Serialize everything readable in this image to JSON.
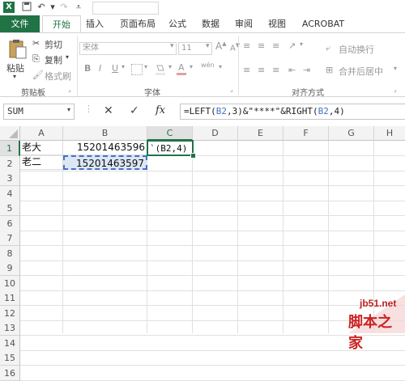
{
  "tabs": [
    "文件",
    "开始",
    "插入",
    "页面布局",
    "公式",
    "数据",
    "审阅",
    "视图",
    "ACROBAT"
  ],
  "clipboard": {
    "cut": "剪切",
    "copy": "复制",
    "format_painter": "格式刷",
    "paste": "粘贴",
    "group": "剪贴板"
  },
  "font": {
    "name": "宋体",
    "size": "11",
    "group": "字体",
    "bold": "B",
    "italic": "I",
    "underline": "U",
    "font_color": "A",
    "phonetic": "wén"
  },
  "alignment": {
    "wrap": "自动换行",
    "merge": "合并后居中",
    "group": "对齐方式"
  },
  "formula_bar": {
    "name_box": "SUM",
    "cancel": "✕",
    "confirm": "✓",
    "fx": "fx",
    "formula_parts": [
      "=LEFT(",
      "B2",
      ",3)&\"****\"&RIGHT(",
      "B2",
      ",4)"
    ]
  },
  "columns": [
    "A",
    "B",
    "C",
    "D",
    "E",
    "F",
    "G",
    "H"
  ],
  "rows": [
    "1",
    "2",
    "3",
    "4",
    "5",
    "6",
    "7",
    "8",
    "9",
    "10",
    "11",
    "12",
    "13",
    "14",
    "15",
    "16"
  ],
  "cells": {
    "A1": "老大",
    "B1": "15201463596",
    "C1": "`(B2,4)",
    "A2": "老二",
    "B2": "15201463597"
  },
  "watermark": {
    "site": "jb51.net",
    "brand": "脚本之家"
  },
  "colors": {
    "accent": "#217346",
    "selection": "#dce6f4",
    "ref_blue": "#4472c4"
  }
}
